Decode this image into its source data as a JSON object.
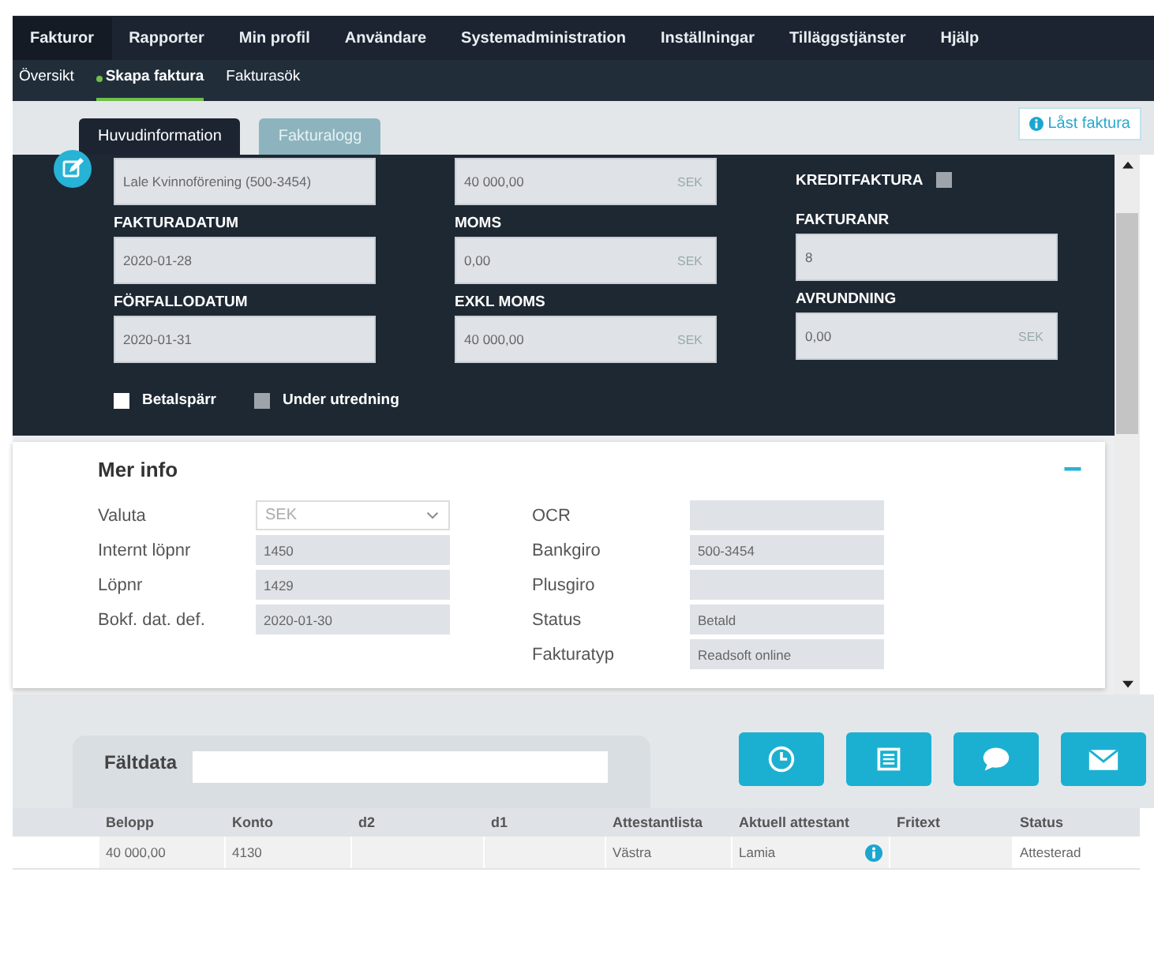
{
  "nav": {
    "items": [
      {
        "label": "Fakturor",
        "selected": true
      },
      {
        "label": "Rapporter",
        "selected": false
      },
      {
        "label": "Min profil",
        "selected": false
      },
      {
        "label": "Användare",
        "selected": false
      },
      {
        "label": "Systemadministration",
        "selected": false
      },
      {
        "label": "Inställningar",
        "selected": false
      },
      {
        "label": "Tilläggstjänster",
        "selected": false
      },
      {
        "label": "Hjälp",
        "selected": false
      }
    ]
  },
  "subnav": {
    "items": [
      {
        "label": "Översikt",
        "selected": false
      },
      {
        "label": "Skapa faktura",
        "selected": true
      },
      {
        "label": "Fakturasök",
        "selected": false
      }
    ]
  },
  "tabs": [
    {
      "label": "Huvudinformation",
      "selected": true
    },
    {
      "label": "Fakturalogg",
      "selected": false
    }
  ],
  "locked_badge": "Låst faktura",
  "invoice_columns": [
    [
      {
        "value": "Lale Kvinnoförening (500-3454)"
      },
      {
        "label": "FAKTURADATUM",
        "value": "2020-01-28"
      },
      {
        "label": "FÖRFALLODATUM",
        "value": "2020-01-31"
      }
    ],
    [
      {
        "value": "40 000,00",
        "unit": "SEK"
      },
      {
        "label": "MOMS",
        "value": "0,00",
        "unit": "SEK"
      },
      {
        "label": "EXKL MOMS",
        "value": "40 000,00",
        "unit": "SEK"
      }
    ],
    [
      {
        "kind": "checkbox",
        "label": "KREDITFAKTURA",
        "checked": false,
        "disabled": true
      },
      {
        "label": "FAKTURANR",
        "value": "8"
      },
      {
        "label": "AVRUNDNING",
        "value": "0,00",
        "unit": "SEK"
      }
    ]
  ],
  "flags": [
    {
      "label": "Betalspärr",
      "checked": false,
      "disabled": false
    },
    {
      "label": "Under utredning",
      "checked": false,
      "disabled": true
    }
  ],
  "mer_info": {
    "title": "Mer info",
    "left": [
      {
        "label": "Valuta",
        "kind": "select",
        "value": "SEK"
      },
      {
        "label": "Internt löpnr",
        "value": "1450"
      },
      {
        "label": "Löpnr",
        "value": "1429"
      },
      {
        "label": "Bokf. dat. def.",
        "value": "2020-01-30"
      }
    ],
    "right": [
      {
        "label": "OCR"
      },
      {
        "label": "Bankgiro",
        "value": "500-3454"
      },
      {
        "label": "Plusgiro"
      },
      {
        "label": "Status",
        "value": "Betald"
      },
      {
        "label": "Fakturatyp",
        "value": "Readsoft online"
      }
    ]
  },
  "faltdata": {
    "label": "Fältdata"
  },
  "table": {
    "columns": [
      "Belopp",
      "Konto",
      "d2",
      "d1",
      "Attestantlista",
      "Aktuell attestant",
      "Fritext",
      "Status"
    ],
    "rows": [
      {
        "cells": [
          "40 000,00",
          "4130",
          null,
          null,
          "Västra",
          "Lamia",
          null,
          "Attesterad"
        ],
        "info": true
      }
    ]
  }
}
